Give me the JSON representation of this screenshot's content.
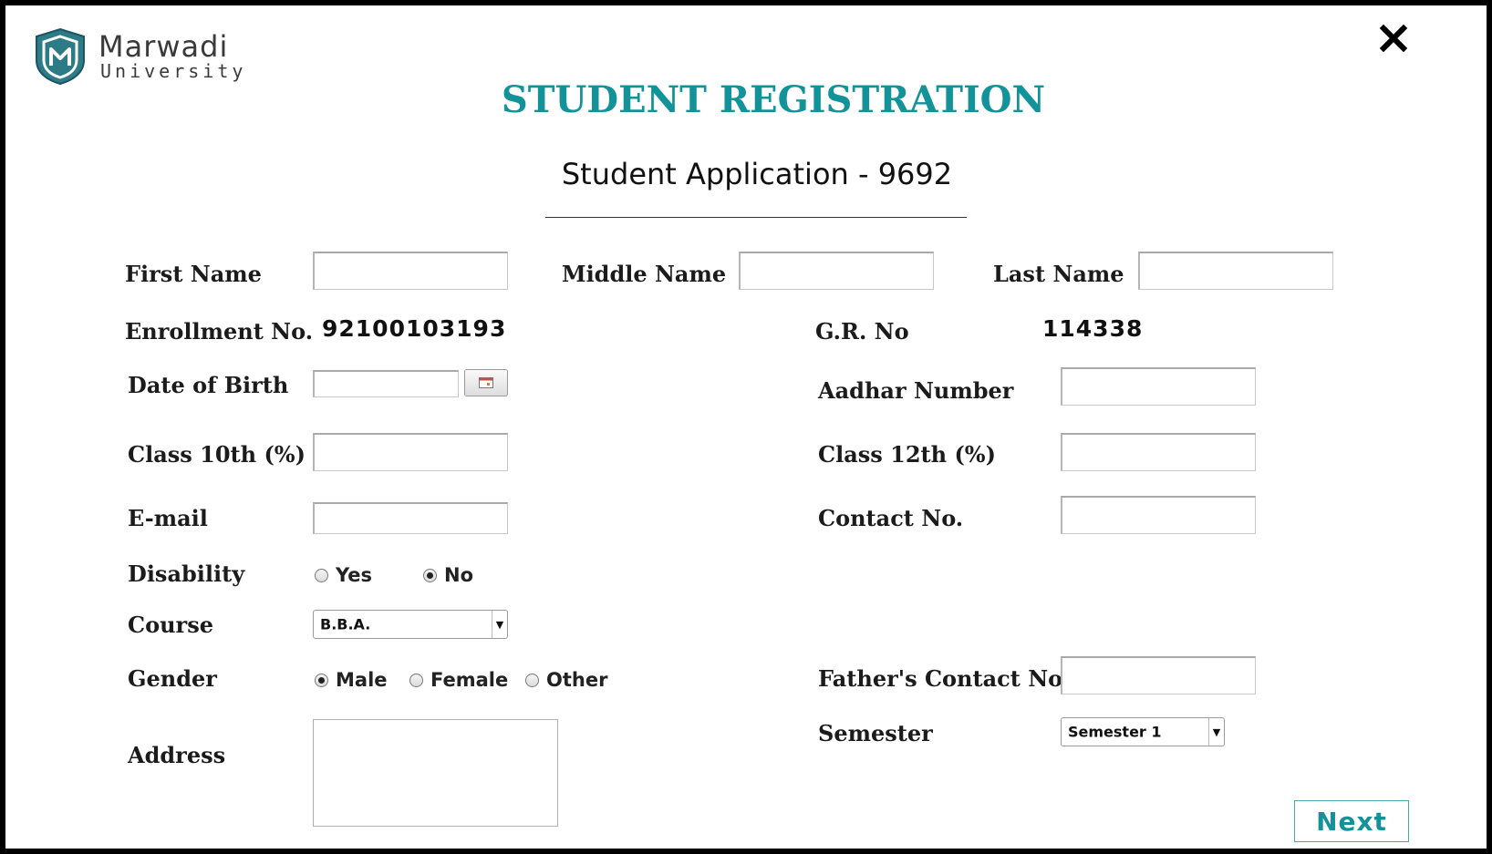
{
  "brand": {
    "name_top": "Marwadi",
    "name_bottom": "University",
    "colors": {
      "teal": "#12939a",
      "logo": "#2e7b88"
    }
  },
  "header": {
    "title": "STUDENT REGISTRATION",
    "subtitle": "Student Application - 9692",
    "close_icon": "close-icon"
  },
  "form": {
    "first_name": {
      "label": "First Name",
      "value": ""
    },
    "middle_name": {
      "label": "Middle Name",
      "value": ""
    },
    "last_name": {
      "label": "Last Name",
      "value": ""
    },
    "enrollment": {
      "label": "Enrollment No.",
      "value": "92100103193"
    },
    "gr_no": {
      "label": "G.R. No",
      "value": "114338"
    },
    "dob": {
      "label": "Date of Birth",
      "value": "",
      "icon": "calendar-icon"
    },
    "aadhar": {
      "label": "Aadhar Number",
      "value": ""
    },
    "class10": {
      "label": "Class 10th (%)",
      "value": ""
    },
    "class12": {
      "label": "Class 12th (%)",
      "value": ""
    },
    "email": {
      "label": "E-mail",
      "value": ""
    },
    "contact": {
      "label": "Contact No.",
      "value": ""
    },
    "disability": {
      "label": "Disability",
      "options": [
        "Yes",
        "No"
      ],
      "selected": "No"
    },
    "course": {
      "label": "Course",
      "selected": "B.B.A."
    },
    "gender": {
      "label": "Gender",
      "options": [
        "Male",
        "Female",
        "Other"
      ],
      "selected": "Male"
    },
    "father_contact": {
      "label": "Father's Contact No.",
      "value": ""
    },
    "semester": {
      "label": "Semester",
      "selected": "Semester 1"
    },
    "address": {
      "label": "Address",
      "value": ""
    }
  },
  "actions": {
    "next_label": "Next"
  }
}
